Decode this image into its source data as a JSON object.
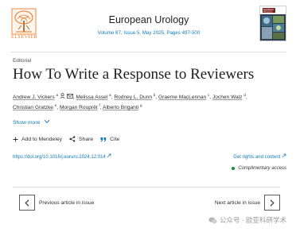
{
  "header": {
    "publisher": "ELSEVIER",
    "journal_title": "European Urology",
    "journal_info": "Volume 87, Issue 5, May 2025, Pages 497-500",
    "cover_label": "EUROPEAN UROLOGY"
  },
  "article": {
    "type": "Editorial",
    "title": "How To Write a Response to Reviewers",
    "authors_line1": [
      {
        "name": "Andrew J. Vickers",
        "sup": "a"
      },
      {
        "name": "Melissa Assel",
        "sup": "a"
      },
      {
        "name": "Rodney L. Dunn",
        "sup": "b"
      },
      {
        "name": "Graeme MacLennan",
        "sup": "c"
      },
      {
        "name": "Jochen Walz",
        "sup": "d"
      }
    ],
    "authors_line2": [
      {
        "name": "Christian Gratzke",
        "sup": "e"
      },
      {
        "name": "Morgan Rouprêt",
        "sup": "f"
      },
      {
        "name": "Alberto Briganti",
        "sup": "g"
      }
    ],
    "show_more": "Show more",
    "actions": {
      "add_to_mendeley": "Add to Mendeley",
      "share": "Share",
      "cite": "Cite"
    },
    "doi": "https://doi.org/10.1016/j.eururo.2024.12.014",
    "rights": "Get rights and content",
    "access": "Complimentary access"
  },
  "navigation": {
    "previous": "Previous article in issue",
    "next": "Next article in issue"
  },
  "watermark": "公众号 · 欧亚科研学术",
  "colors": {
    "link": "#0c7dbb",
    "elsevier_orange": "#e9711c",
    "access_green": "#1b8b3a"
  }
}
